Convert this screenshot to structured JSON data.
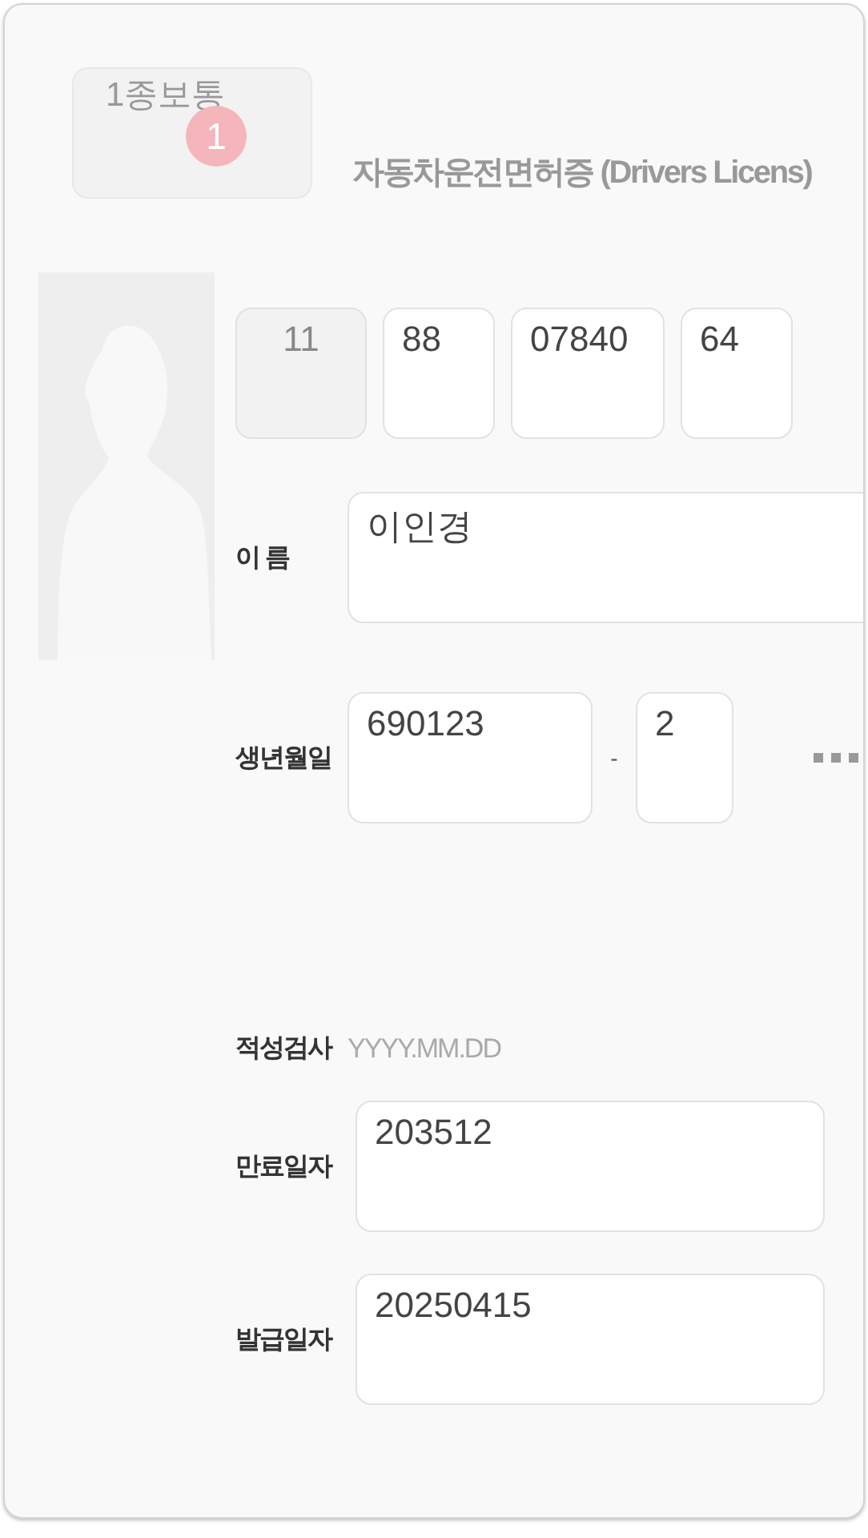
{
  "license_class": {
    "label": "1종보통",
    "badge": "1"
  },
  "title": "자동차운전면허증 (Drivers Licens)",
  "license_number": [
    {
      "value": "11",
      "disabled": true
    },
    {
      "value": "88",
      "disabled": false
    },
    {
      "value": "07840",
      "disabled": false
    },
    {
      "value": "64",
      "disabled": false
    }
  ],
  "fields": [
    {
      "kind": "text",
      "label": "이 름",
      "value": "이인경"
    },
    {
      "kind": "birth",
      "label": "생년월일",
      "value": "690123",
      "separator": "-",
      "suffix": "2"
    },
    {
      "kind": "date",
      "label": "적성검사",
      "placeholder": "YYYY.MM.DD"
    },
    {
      "kind": "text",
      "label": "만료일자",
      "value": "203512"
    },
    {
      "kind": "text",
      "label": "발급일자",
      "value": "20250415"
    }
  ]
}
